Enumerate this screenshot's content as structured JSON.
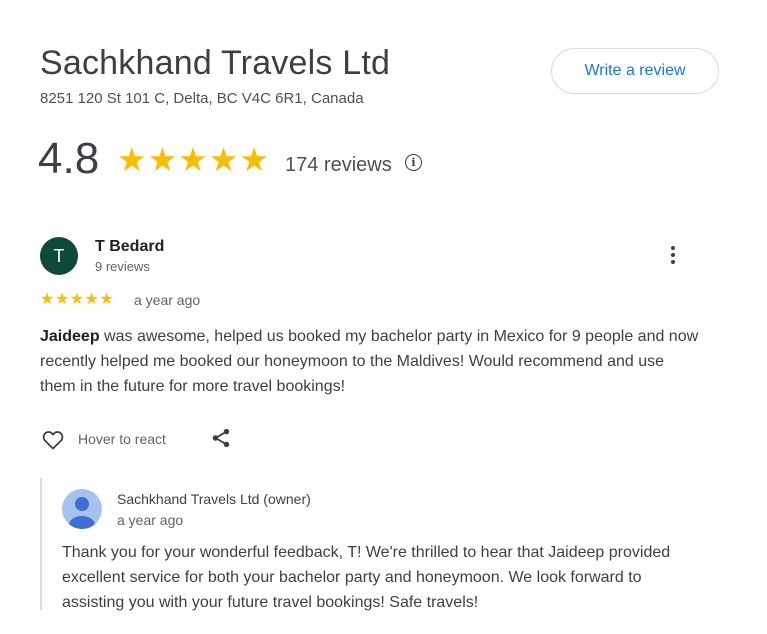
{
  "business": {
    "name": "Sachkhand Travels Ltd",
    "address": "8251 120 St 101 C, Delta, BC V4C 6R1, Canada",
    "write_review_label": "Write a review"
  },
  "rating": {
    "value": "4.8",
    "stars": "★★★★★",
    "count_label": "174 reviews",
    "info_glyph": "i"
  },
  "review": {
    "avatar_letter": "T",
    "reviewer_name": "T Bedard",
    "reviewer_count": "9 reviews",
    "stars": "★★★★★",
    "rating_value": 5,
    "time": "a year ago",
    "text_bold": "Jaideep",
    "text_rest": " was awesome, helped us booked my bachelor party in Mexico for 9 people and now recently helped me booked our honeymoon to the Maldives! Would recommend and use them in the future for more travel bookings!",
    "react_label": "Hover to react"
  },
  "owner_reply": {
    "name": "Sachkhand Travels Ltd (owner)",
    "time": "a year ago",
    "text": "Thank you for your wonderful feedback, T! We're thrilled to hear that Jaideep provided excellent service for both your bachelor party and honeymoon. We look forward to assisting you with your future travel bookings! Safe travels!"
  },
  "icons": {
    "info": "info-icon",
    "more": "more-vert-icon",
    "heart": "heart-outline-icon",
    "share": "share-icon",
    "owner_avatar": "person-avatar-icon"
  },
  "colors": {
    "accent": "#1a73e8",
    "star": "#fbbc04",
    "avatar": "#0d4a3b",
    "owner_avatar": "#a6c3ee"
  }
}
